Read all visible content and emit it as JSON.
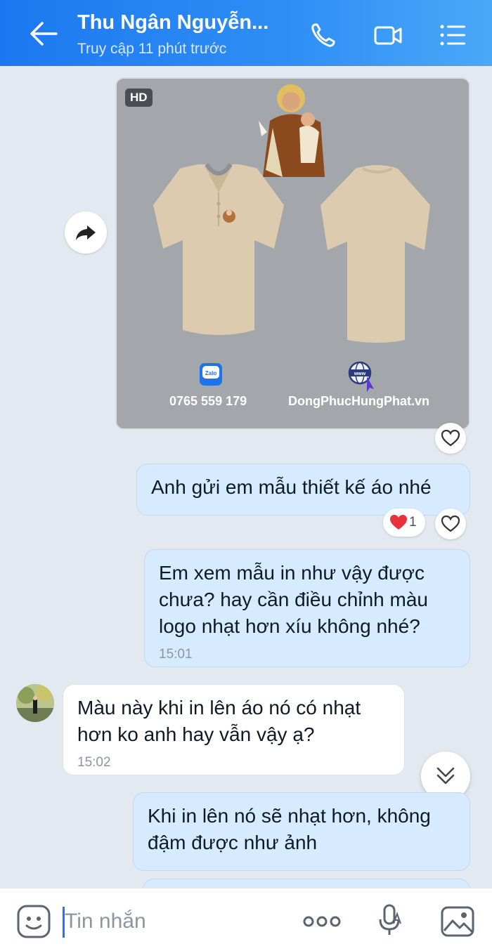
{
  "header": {
    "contact_name": "Thu Ngân Nguyễn...",
    "status": "Truy cập 11 phút trước",
    "icons": [
      "back-arrow-icon",
      "phone-icon",
      "video-call-icon",
      "menu-list-icon"
    ]
  },
  "image_message": {
    "hd_badge": "HD",
    "phone": "0765 559 179",
    "website": "DongPhucHungPhat.vn",
    "zalo_label": "Zalo",
    "www_label": "www"
  },
  "messages": [
    {
      "sender": "me",
      "text": "Anh gửi em mẫu thiết kế áo nhé",
      "time": ""
    },
    {
      "sender": "me",
      "text": "Em xem mẫu in như vậy được chưa? hay cần điều chỉnh màu logo nhạt hơn xíu không nhé?",
      "time": "15:01"
    },
    {
      "sender": "them",
      "text": "Màu này khi in lên áo nó có nhạt hơn ko anh hay vẫn vậy ạ?",
      "time": "15:02"
    },
    {
      "sender": "me",
      "text": "Khi in lên nó sẽ nhạt hơn, không đậm được như ảnh",
      "time": ""
    }
  ],
  "reaction": {
    "count": "1",
    "color": "#e8323c"
  },
  "input": {
    "placeholder": "Tin nhắn"
  },
  "colors": {
    "header": "#1b78f0",
    "my_bubble": "#d6ebff",
    "background": "#e2e9f1"
  }
}
